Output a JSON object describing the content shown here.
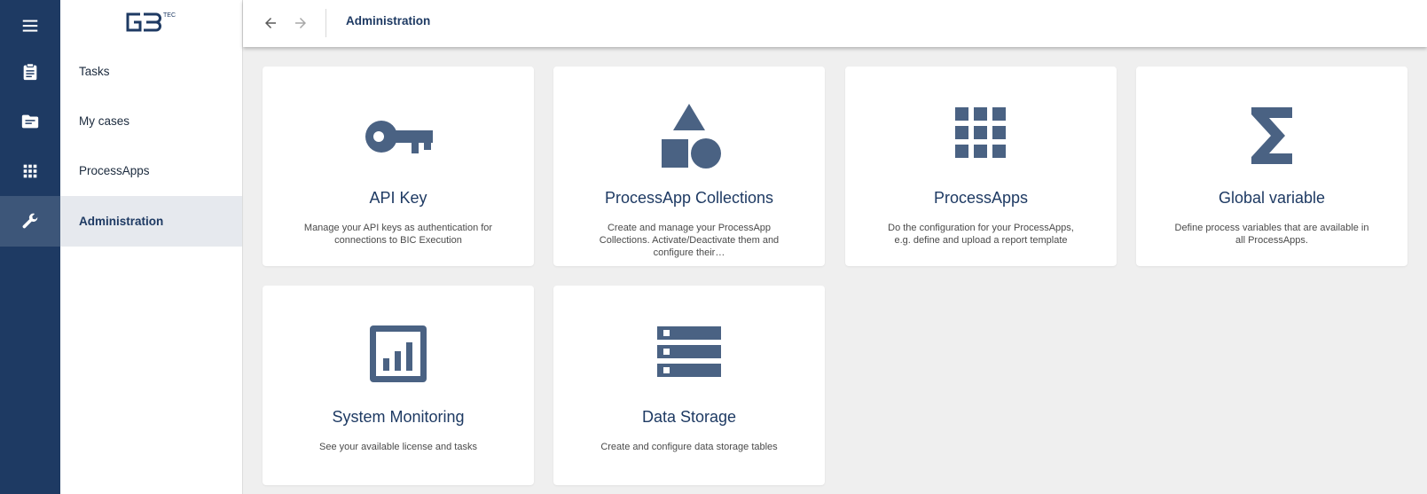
{
  "app": {
    "logo_text": "TEC"
  },
  "header": {
    "back_label": "Back",
    "forward_label": "Forward",
    "title": "Administration"
  },
  "rail": {
    "items": [
      {
        "icon": "menu-icon"
      },
      {
        "icon": "clipboard-icon"
      },
      {
        "icon": "folder-icon"
      },
      {
        "icon": "apps-grid-icon"
      },
      {
        "icon": "wrench-icon",
        "active": true
      }
    ]
  },
  "nav": {
    "items": [
      {
        "label": "Tasks"
      },
      {
        "label": "My cases"
      },
      {
        "label": "ProcessApps"
      },
      {
        "label": "Administration",
        "active": true
      }
    ]
  },
  "cards": [
    {
      "icon": "key-icon",
      "title": "API Key",
      "description": "Manage your API keys as authentication for connections to BIC Execution"
    },
    {
      "icon": "shapes-icon",
      "title": "ProcessApp Collections",
      "description": "Create and manage your ProcessApp Collections. Activate/Deactivate them and configure their…"
    },
    {
      "icon": "grid-icon",
      "title": "ProcessApps",
      "description": "Do the configuration for your ProcessApps, e.g. define and upload a report template"
    },
    {
      "icon": "sigma-icon",
      "title": "Global variable",
      "description": "Define process variables that are available in all ProcessApps."
    },
    {
      "icon": "monitoring-icon",
      "title": "System Monitoring",
      "description": "See your available license and tasks"
    },
    {
      "icon": "storage-icon",
      "title": "Data Storage",
      "description": "Create and configure data storage tables"
    }
  ],
  "colors": {
    "rail": "#1e3a63",
    "rail_active": "#3d5679",
    "accent": "#1e3a63",
    "icon": "#4a6283",
    "background": "#efefef"
  }
}
